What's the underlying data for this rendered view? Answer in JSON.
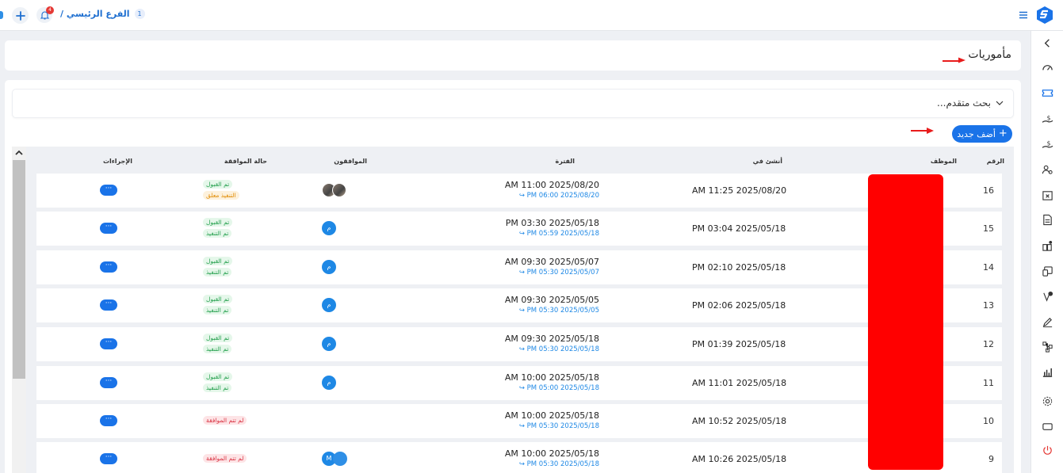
{
  "app": {
    "brand_color": "#1a73e8",
    "logo_icon": "app-logo-icon",
    "breadcrumb": {
      "label": "الفرع الرئيسي /",
      "count": "1"
    },
    "notification_count": "4"
  },
  "page": {
    "title": "مأموريات"
  },
  "search": {
    "label": "بحث متقدم..."
  },
  "actions": {
    "add_label": "أضف جديد"
  },
  "table": {
    "headers": {
      "number": "الرقم",
      "employee": "الموظف",
      "created": "أنشئ في",
      "period": "الفترة",
      "approvers": "الموافقون",
      "status": "حالة الموافقة",
      "actions": "الإجراءات"
    },
    "rows": [
      {
        "number": "16",
        "created": "AM 11:25 2025/08/20",
        "period_start": "AM 11:00 2025/08/20",
        "period_end": "PM 06:00 2025/08/20 ↪",
        "approvers": "photo",
        "status": [
          "تم القبول",
          "التنفيذ معلق"
        ],
        "status_colors": [
          "green",
          "orange"
        ],
        "actions": "···"
      },
      {
        "number": "15",
        "created": "PM 03:04 2025/05/18",
        "period_start": "PM 03:30 2025/05/18",
        "period_end": "PM 05:59 2025/05/18 ↪",
        "approvers": "م",
        "status": [
          "تم القبول",
          "تم التنفيذ"
        ],
        "status_colors": [
          "green",
          "green"
        ],
        "actions": "···"
      },
      {
        "number": "14",
        "created": "PM 02:10 2025/05/18",
        "period_start": "AM 09:30 2025/05/07",
        "period_end": "PM 05:30 2025/05/07 ↪",
        "approvers": "م",
        "status": [
          "تم القبول",
          "تم التنفيذ"
        ],
        "status_colors": [
          "green",
          "green"
        ],
        "actions": "···"
      },
      {
        "number": "13",
        "created": "PM 02:06 2025/05/18",
        "period_start": "AM 09:30 2025/05/05",
        "period_end": "PM 05:30 2025/05/05 ↪",
        "approvers": "م",
        "status": [
          "تم القبول",
          "تم التنفيذ"
        ],
        "status_colors": [
          "green",
          "green"
        ],
        "actions": "···"
      },
      {
        "number": "12",
        "created": "PM 01:39 2025/05/18",
        "period_start": "AM 09:30 2025/05/18",
        "period_end": "PM 05:30 2025/05/18 ↪",
        "approvers": "م",
        "status": [
          "تم القبول",
          "تم التنفيذ"
        ],
        "status_colors": [
          "green",
          "green"
        ],
        "actions": "···"
      },
      {
        "number": "11",
        "created": "AM 11:01 2025/05/18",
        "period_start": "AM 10:00 2025/05/18",
        "period_end": "PM 05:00 2025/05/18 ↪",
        "approvers": "م",
        "status": [
          "تم القبول",
          "تم التنفيذ"
        ],
        "status_colors": [
          "green",
          "green"
        ],
        "actions": "···"
      },
      {
        "number": "10",
        "created": "AM 10:52 2025/05/18",
        "period_start": "AM 10:00 2025/05/18",
        "period_end": "PM 05:30 2025/05/18 ↪",
        "approvers": "",
        "status": [
          "لم تتم الموافقة"
        ],
        "status_colors": [
          "red"
        ],
        "actions": "···"
      },
      {
        "number": "9",
        "created": "AM 10:26 2025/05/18",
        "period_start": "AM 10:00 2025/05/18",
        "period_end": "PM 05:30 2025/05/18 ↪",
        "approvers": "M+logo",
        "status": [
          "لم تتم الموافقة"
        ],
        "status_colors": [
          "red"
        ],
        "actions": "···"
      }
    ]
  }
}
